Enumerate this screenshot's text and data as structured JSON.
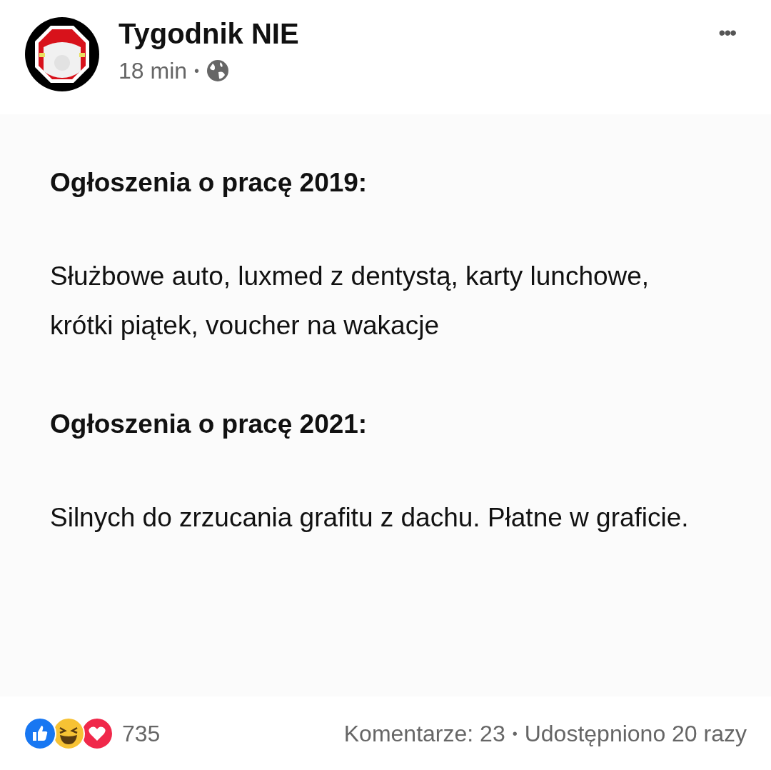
{
  "post": {
    "author": "Tygodnik NIE",
    "time": "18 min",
    "separator": "•",
    "menu": "•••"
  },
  "content": {
    "paragraphs": [
      {
        "kind": "heading",
        "text": "Ogłoszenia o pracę 2019:"
      },
      {
        "kind": "body",
        "text": "Służbowe auto, luxmed z dentystą, karty lunchowe, krótki piątek, voucher na wakacje"
      },
      {
        "kind": "heading",
        "text": "Ogłoszenia o pracę 2021:"
      },
      {
        "kind": "body",
        "text": "Silnych do zrzucania grafitu z dachu. Płatne w graficie."
      }
    ]
  },
  "footer": {
    "reaction_count": "735",
    "comments": "Komentarze: 23",
    "separator": "•",
    "shares": "Udostępniono 20 razy"
  }
}
